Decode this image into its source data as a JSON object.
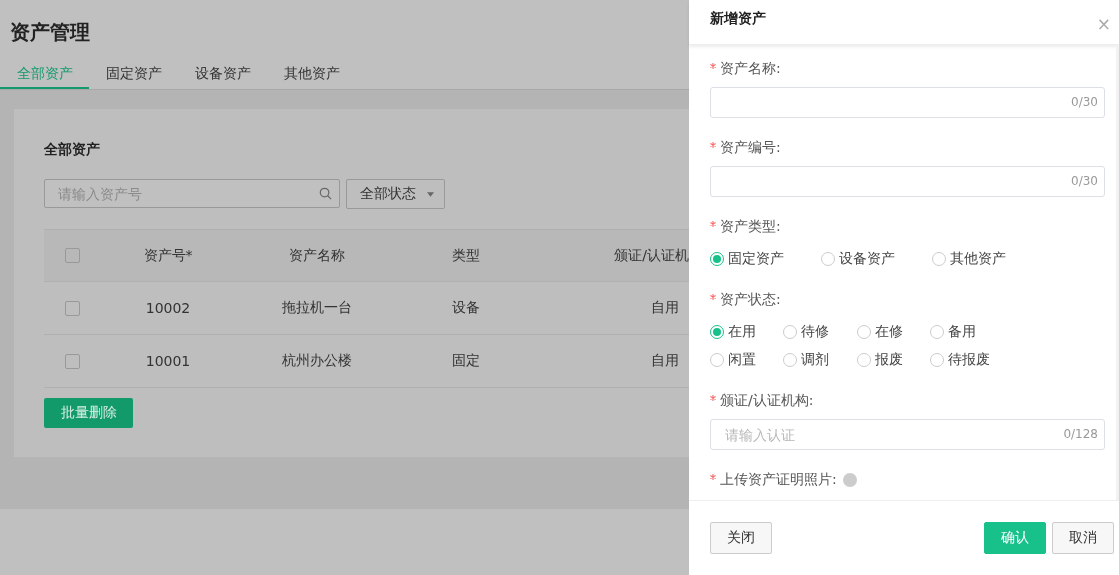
{
  "page": {
    "title": "资产管理",
    "tabs": [
      {
        "label": "全部资产",
        "selected": true
      },
      {
        "label": "固定资产",
        "selected": false
      },
      {
        "label": "设备资产",
        "selected": false
      },
      {
        "label": "其他资产",
        "selected": false
      }
    ],
    "card": {
      "title": "全部资产",
      "search": {
        "placeholder": "请输入资产号"
      },
      "status_filter": {
        "value": "全部状态"
      },
      "table": {
        "header_checkbox": {
          "checked": false
        },
        "columns": [
          "资产号*",
          "资产名称",
          "类型",
          "颁证/认证机"
        ],
        "rows": [
          {
            "checked": false,
            "cells": [
              "10002",
              "拖拉机一台",
              "设备",
              "自用"
            ]
          },
          {
            "checked": false,
            "cells": [
              "10001",
              "杭州办公楼",
              "固定",
              "自用"
            ]
          }
        ]
      },
      "bulk_delete_button": "批量删除"
    }
  },
  "drawer": {
    "title": "新增资产",
    "close_icon": "×",
    "fields": [
      {
        "kind": "input",
        "label": "资产名称:",
        "required": true,
        "counter": "0/30"
      },
      {
        "kind": "input",
        "label": "资产编号:",
        "required": true,
        "counter": "0/30"
      },
      {
        "kind": "radio",
        "label": "资产类型:",
        "required": true,
        "options": [
          {
            "label": "固定资产",
            "selected": true
          },
          {
            "label": "设备资产",
            "selected": false
          },
          {
            "label": "其他资产",
            "selected": false
          }
        ]
      },
      {
        "kind": "radio",
        "label": "资产状态:",
        "required": true,
        "options": [
          {
            "label": "在用",
            "selected": true
          },
          {
            "label": "待修",
            "selected": false
          },
          {
            "label": "在修",
            "selected": false
          },
          {
            "label": "备用",
            "selected": false
          },
          {
            "label": "闲置",
            "selected": false
          },
          {
            "label": "调剂",
            "selected": false
          },
          {
            "label": "报废",
            "selected": false
          },
          {
            "label": "待报废",
            "selected": false
          }
        ]
      },
      {
        "kind": "input",
        "label": "颁证/认证机构:",
        "required": true,
        "placeholder": "请输入认证",
        "counter": "0/128"
      },
      {
        "kind": "upload",
        "label": "上传资产证明照片:",
        "required": true,
        "help": true
      }
    ],
    "footer": {
      "close_button": "关闭",
      "confirm_button": "确认",
      "cancel_button": "取消"
    }
  }
}
